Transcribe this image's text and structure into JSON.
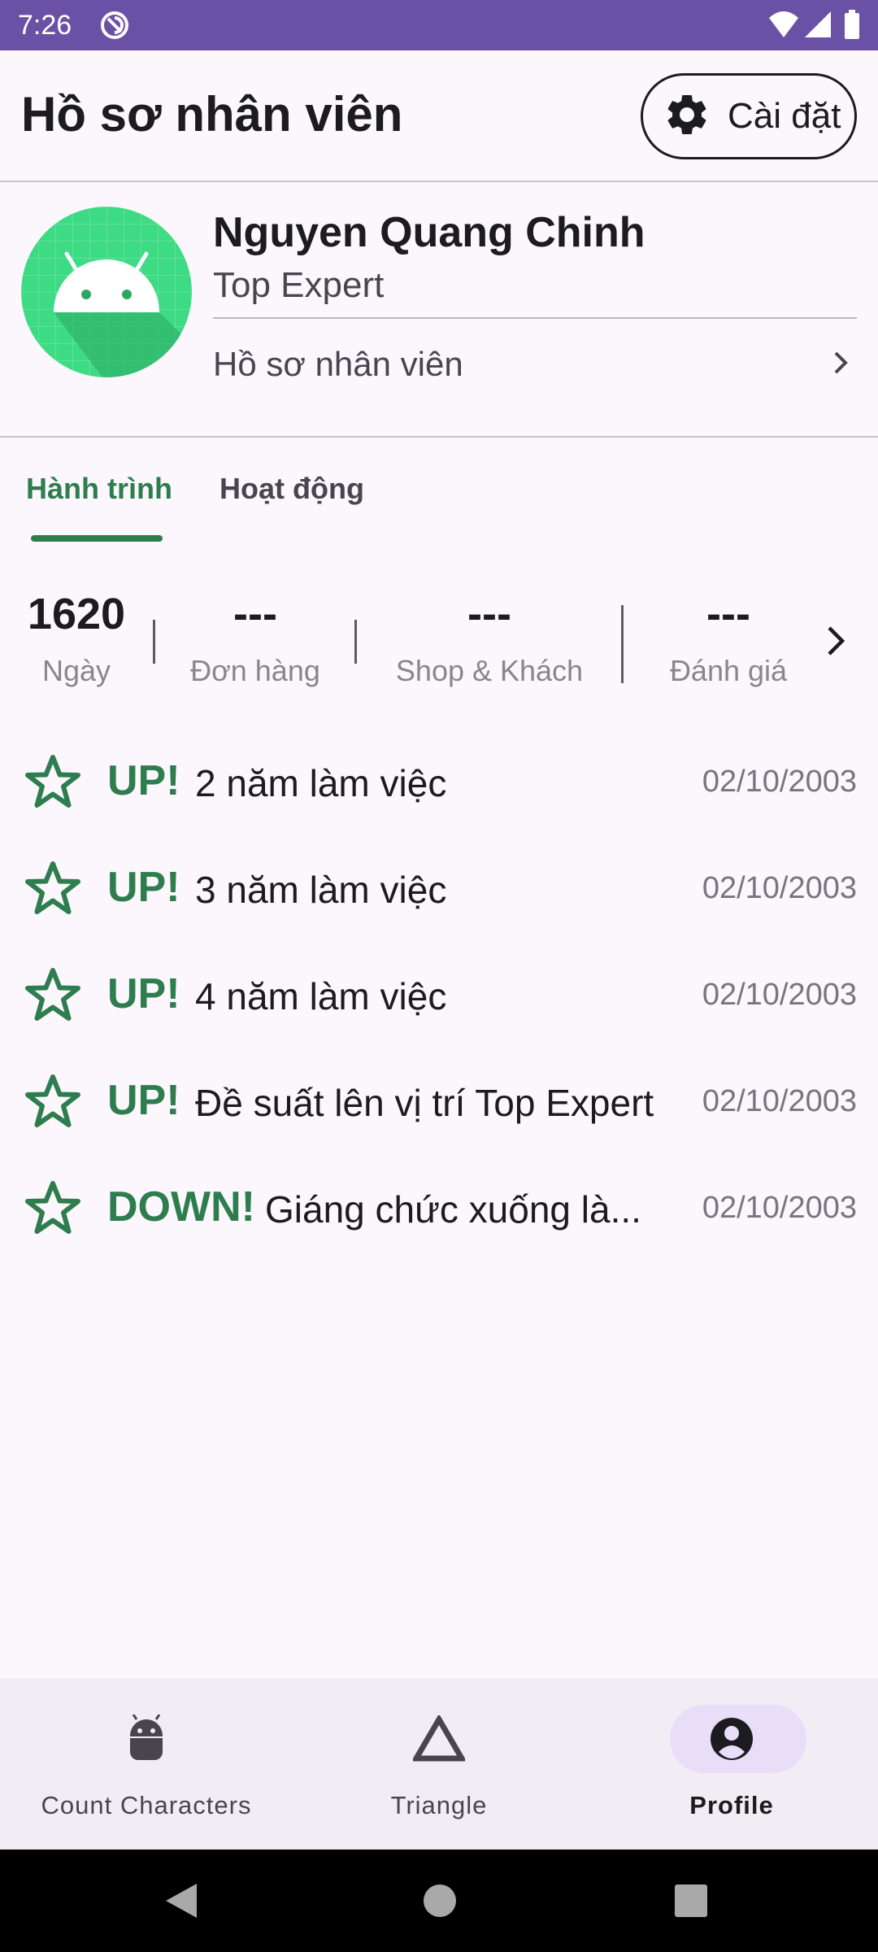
{
  "status_bar": {
    "time": "7:26"
  },
  "app_bar": {
    "title": "Hồ sơ nhân viên",
    "settings_label": "Cài đặt"
  },
  "profile": {
    "name": "Nguyen Quang Chinh",
    "role": "Top Expert",
    "link_label": "Hồ sơ nhân viên"
  },
  "tabs": [
    {
      "label": "Hành trình",
      "active": true
    },
    {
      "label": "Hoạt động",
      "active": false
    }
  ],
  "stats": [
    {
      "value": "1620",
      "label": "Ngày"
    },
    {
      "value": "---",
      "label": "Đơn hàng"
    },
    {
      "value": "---",
      "label": "Shop & Khách"
    },
    {
      "value": "---",
      "label": "Đánh giá"
    }
  ],
  "events": [
    {
      "tag": "UP!",
      "text": "2 năm làm việc",
      "date": "02/10/2003"
    },
    {
      "tag": "UP!",
      "text": "3 năm làm việc",
      "date": "02/10/2003"
    },
    {
      "tag": "UP!",
      "text": "4 năm làm việc",
      "date": "02/10/2003"
    },
    {
      "tag": "UP!",
      "text": "Đề suất lên vị trí Top Expert",
      "date": "02/10/2003"
    },
    {
      "tag": "DOWN!",
      "text": "Giáng chức xuống là...",
      "date": "02/10/2003"
    }
  ],
  "bottom_nav": [
    {
      "label": "Count Characters",
      "icon": "android-icon",
      "active": false
    },
    {
      "label": "Triangle",
      "icon": "triangle-icon",
      "active": false
    },
    {
      "label": "Profile",
      "icon": "account-circle-icon",
      "active": true
    }
  ],
  "colors": {
    "status_bar": "#6a51a6",
    "accent_green": "#2e7d4f",
    "background": "#fcf7fc",
    "nav_background": "#f2ecf4",
    "nav_active_pill": "#e8def8"
  }
}
